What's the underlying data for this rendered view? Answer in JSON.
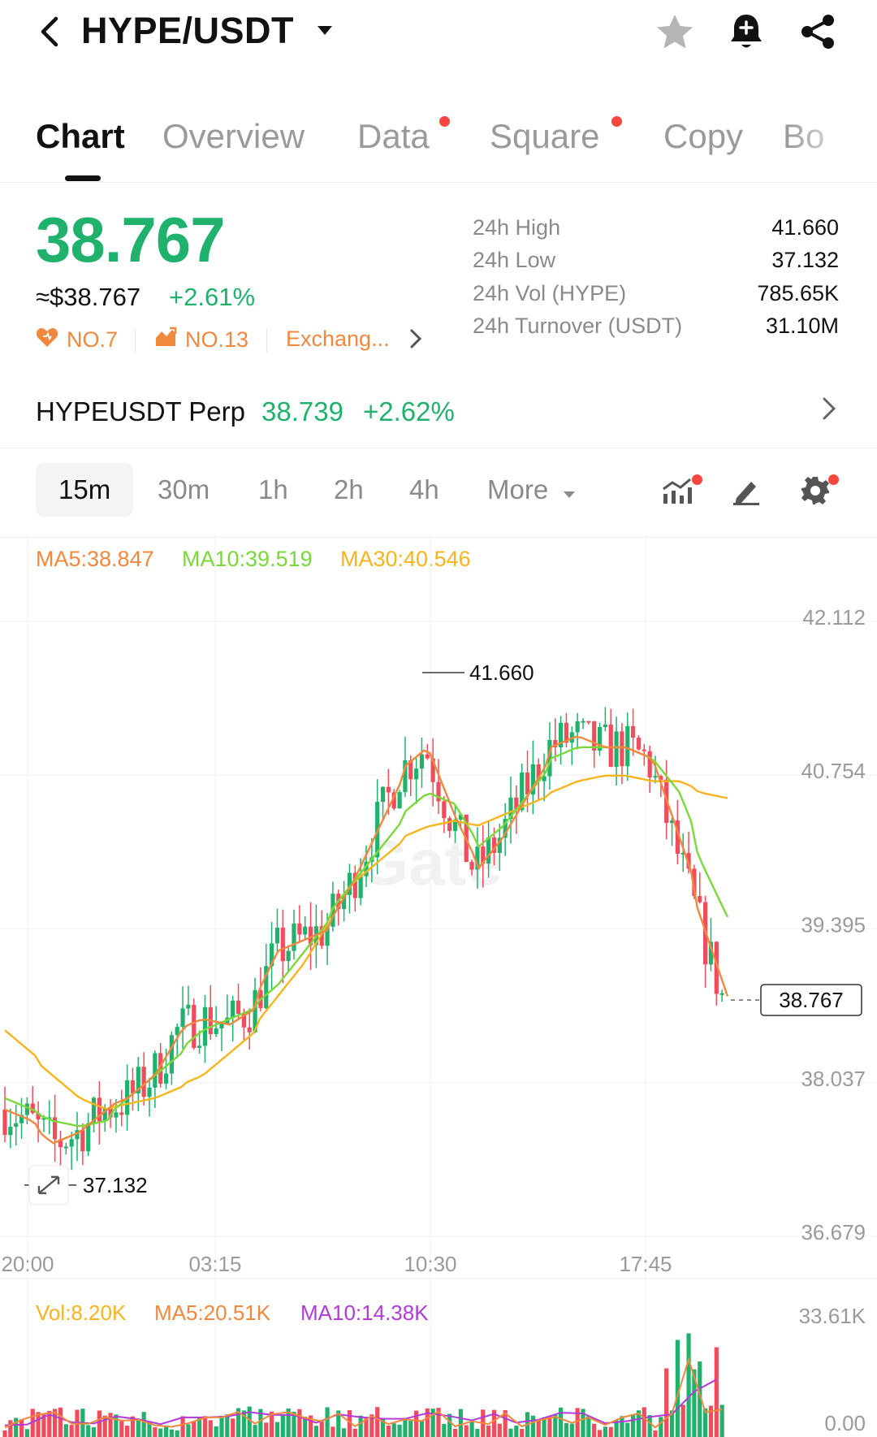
{
  "header": {
    "pair": "HYPE/USDT",
    "icons": [
      "back-arrow-icon",
      "star-icon",
      "bell-plus-icon",
      "share-icon"
    ]
  },
  "tabs": [
    {
      "label": "Chart",
      "active": true
    },
    {
      "label": "Overview"
    },
    {
      "label": "Data",
      "dot": true
    },
    {
      "label": "Square",
      "dot": true
    },
    {
      "label": "Copy"
    },
    {
      "label": "Bo"
    }
  ],
  "price": {
    "last": "38.767",
    "usd": "≈$38.767",
    "change": "+2.61%",
    "rank1": "NO.7",
    "rank2": "NO.13",
    "exchange": "Exchang..."
  },
  "stats": [
    {
      "label": "24h High",
      "value": "41.660"
    },
    {
      "label": "24h Low",
      "value": "37.132"
    },
    {
      "label": "24h Vol (HYPE)",
      "value": "785.65K"
    },
    {
      "label": "24h Turnover (USDT)",
      "value": "31.10M"
    }
  ],
  "perp": {
    "name": "HYPEUSDT Perp",
    "price": "38.739",
    "change": "+2.62%"
  },
  "timeframes": {
    "items": [
      "15m",
      "30m",
      "1h",
      "2h",
      "4h"
    ],
    "active": "15m",
    "more": "More"
  },
  "ma": {
    "ma5": "MA5:38.847",
    "ma10": "MA10:39.519",
    "ma30": "MA30:40.546"
  },
  "colors": {
    "up": "#20b26c",
    "down": "#ef4d5b",
    "ma5": "#f0883e",
    "ma10": "#7ad83a",
    "ma30": "#f6b51e",
    "vol_ma10": "#b03bd8"
  },
  "chart_data": {
    "type": "candlestick",
    "y_ticks": [
      "42.112",
      "40.754",
      "39.395",
      "38.037",
      "36.679"
    ],
    "x_ticks": [
      "20:00",
      "03:15",
      "10:30",
      "17:45"
    ],
    "ylim": [
      36.679,
      42.112
    ],
    "high_marker": "41.660",
    "low_marker": "37.132",
    "last_price_tag": "38.767",
    "ma5_series": [
      37.8,
      37.7,
      37.5,
      37.6,
      37.8,
      37.9,
      38.1,
      38.5,
      38.6,
      38.55,
      38.7,
      39.2,
      39.3,
      39.4,
      39.8,
      40.3,
      40.8,
      41.0,
      40.4,
      39.9,
      40.2,
      40.6,
      41.0,
      41.1,
      41.0,
      41.0,
      40.9,
      40.2,
      39.5,
      38.8
    ],
    "ma10_series": [
      37.9,
      37.8,
      37.7,
      37.65,
      37.7,
      37.9,
      38.1,
      38.3,
      38.5,
      38.6,
      38.7,
      38.9,
      39.2,
      39.5,
      39.8,
      40.1,
      40.4,
      40.6,
      40.5,
      40.1,
      40.3,
      40.6,
      40.9,
      41.0,
      41.0,
      41.0,
      40.9,
      40.6,
      40.0,
      39.5
    ],
    "ma30_series": [
      38.5,
      38.3,
      38.1,
      37.9,
      37.8,
      37.85,
      37.9,
      38.0,
      38.1,
      38.3,
      38.5,
      38.8,
      39.1,
      39.5,
      39.8,
      40.0,
      40.2,
      40.3,
      40.35,
      40.3,
      40.4,
      40.5,
      40.6,
      40.7,
      40.75,
      40.75,
      40.7,
      40.7,
      40.6,
      40.55
    ],
    "volume": {
      "vol": "Vol:8.20K",
      "ma5": "MA5:20.51K",
      "ma10": "MA10:14.38K",
      "y_ticks": [
        "33.61K",
        "0.00"
      ]
    }
  }
}
